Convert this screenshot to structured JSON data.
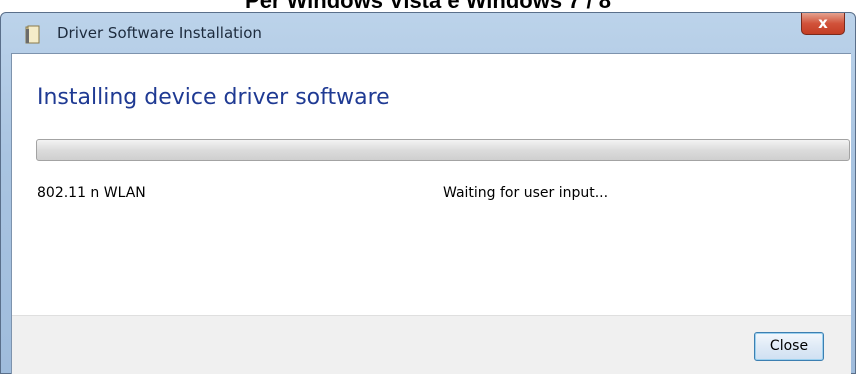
{
  "page": {
    "heading": "Per Windows Vista e Windows 7 / 8"
  },
  "window": {
    "title": "Driver Software Installation",
    "close_glyph": "x",
    "icon": "folder-icon"
  },
  "main": {
    "heading": "Installing device driver software",
    "progress": 0.0
  },
  "device": {
    "name": "802.11 n WLAN",
    "status": "Waiting for user input..."
  },
  "footer": {
    "close_label": "Close"
  },
  "colors": {
    "heading_blue": "#1f3a93",
    "title_bar": "#a9c4e1",
    "close_red": "#c43e24"
  }
}
